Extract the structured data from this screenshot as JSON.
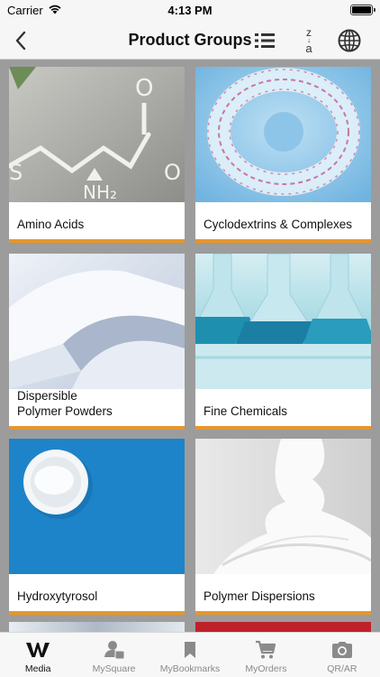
{
  "status_bar": {
    "carrier": "Carrier",
    "time": "4:13 PM"
  },
  "nav": {
    "title": "Product Groups",
    "sort_glyph_top": "z",
    "sort_glyph_bottom": "a"
  },
  "cards": [
    {
      "label": "Amino Acids",
      "image": "amino-acid-structure-image"
    },
    {
      "label": "Cyclodextrins & Complexes",
      "image": "cyclodextrin-molecule-image"
    },
    {
      "label": "Dispersible\nPolymer Powders",
      "image": "white-powder-image"
    },
    {
      "label": "Fine Chemicals",
      "image": "laboratory-flasks-image"
    },
    {
      "label": "Hydroxytyrosol",
      "image": "powder-bowl-image"
    },
    {
      "label": "Polymer Dispersions",
      "image": "white-dispersion-image"
    }
  ],
  "tabs": [
    {
      "label": "Media",
      "icon": "w-logo-icon",
      "active": true
    },
    {
      "label": "MySquare",
      "icon": "person-card-icon",
      "active": false
    },
    {
      "label": "MyBookmarks",
      "icon": "bookmark-icon",
      "active": false
    },
    {
      "label": "MyOrders",
      "icon": "cart-icon",
      "active": false
    },
    {
      "label": "QR/AR",
      "icon": "camera-icon",
      "active": false
    }
  ],
  "colors": {
    "accent": "#e8962a",
    "background": "#9c9c9c",
    "bar": "#f6f6f6"
  }
}
